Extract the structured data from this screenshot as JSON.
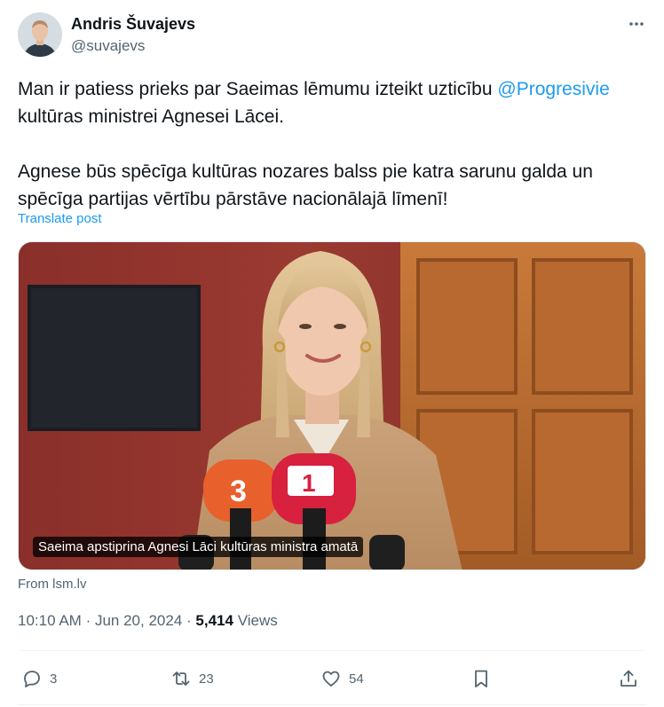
{
  "author": {
    "name": "Andris Šuvajevs",
    "handle": "@suvajevs"
  },
  "tweet": {
    "line1_prefix": "Man ir patiess prieks par Saeimas lēmumu izteikt uzticību",
    "mention": "@Progresivie",
    "line1_suffix": "kultūras ministrei Agnesei Lācei.",
    "paragraph2": "Agnese būs spēcīga kultūras nozares balss pie katra sarunu galda un spēcīga partijas vērtību pārstāve nacionālajā līmenī!"
  },
  "translate_label": "Translate post",
  "card": {
    "caption": "Saeima apstiprina Agnesi Lāci kultūras ministra amatā",
    "source": "From lsm.lv"
  },
  "meta": {
    "time": "10:10 AM",
    "separator": "·",
    "date": "Jun 20, 2024",
    "views_count": "5,414",
    "views_label": "Views"
  },
  "actions": {
    "replies": "3",
    "reposts": "23",
    "likes": "54"
  },
  "icons": [
    "more-icon",
    "reply-icon",
    "repost-icon",
    "like-icon",
    "bookmark-icon",
    "share-icon"
  ],
  "colors": {
    "accent": "#1d9bf0",
    "text": "#0f1419",
    "secondary": "#536471"
  }
}
